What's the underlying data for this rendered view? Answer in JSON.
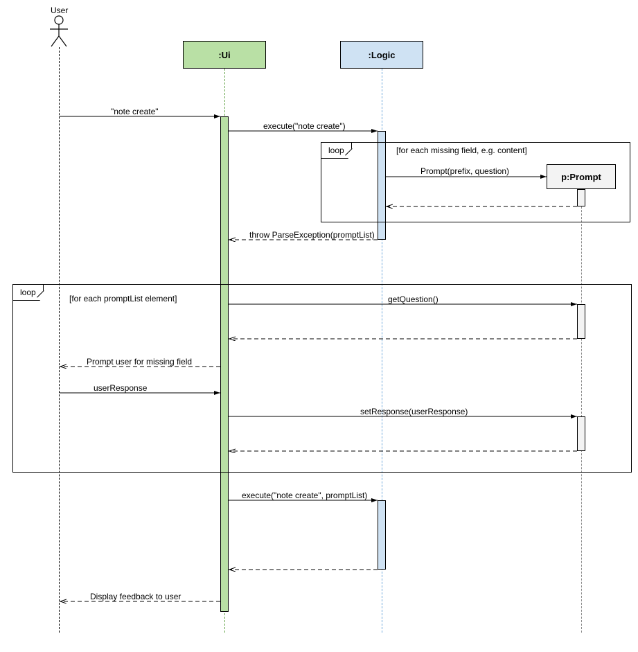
{
  "actors": {
    "user": "User",
    "ui": ":Ui",
    "logic": ":Logic",
    "prompt": "p:Prompt"
  },
  "loops": {
    "loop1": {
      "tag": "loop",
      "guard": "[for each missing field, e.g. content]"
    },
    "loop2": {
      "tag": "loop",
      "guard": "[for each promptList element]"
    }
  },
  "messages": {
    "m1": "\"note create\"",
    "m2": "execute(\"note create\")",
    "m3": "Prompt(prefix, question)",
    "m4": "throw ParseException(promptList)",
    "m5": "getQuestion()",
    "m6": "Prompt user for missing field",
    "m7": "userResponse",
    "m8": "setResponse(userResponse)",
    "m9": "execute(\"note create\", promptList)",
    "m10": "Display feedback to user"
  }
}
